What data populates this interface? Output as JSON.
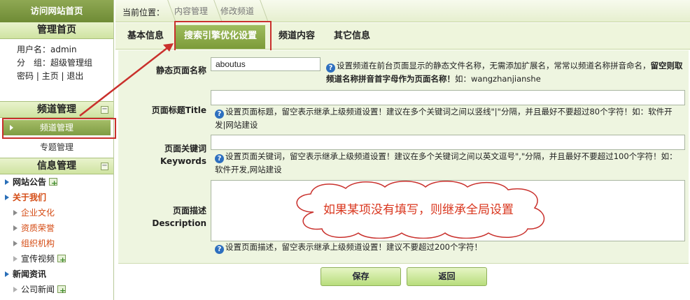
{
  "sidebar": {
    "top_link": "访问网站首页",
    "manage_home": "管理首页",
    "user": {
      "name_label": "用户名：",
      "name_value": "admin",
      "group_label": "分　组：",
      "group_value": "超级管理组",
      "links": [
        "密码",
        "主页",
        "退出"
      ]
    },
    "channel_section": "频道管理",
    "channel_items": [
      "频道管理",
      "专题管理"
    ],
    "info_section": "信息管理",
    "tree": [
      {
        "label": "网站公告",
        "level": 1,
        "style": "bold",
        "add": true
      },
      {
        "label": "关于我们",
        "level": 1,
        "style": "red",
        "add": false
      },
      {
        "label": "企业文化",
        "level": 2,
        "style": "orange",
        "add": false
      },
      {
        "label": "资质荣誉",
        "level": 2,
        "style": "orange",
        "add": false
      },
      {
        "label": "组织机构",
        "level": 2,
        "style": "orange",
        "add": false
      },
      {
        "label": "宣传视频",
        "level": 2,
        "style": "normal",
        "add": true
      },
      {
        "label": "新闻资讯",
        "level": 1,
        "style": "bold",
        "add": false
      },
      {
        "label": "公司新闻",
        "level": 2,
        "style": "normal",
        "add": true
      }
    ]
  },
  "topbar": {
    "label": "当前位置：",
    "crumbs": [
      "内容管理",
      "修改频道"
    ]
  },
  "tabs": [
    "基本信息",
    "搜索引擎优化设置",
    "频道内容",
    "其它信息"
  ],
  "form": {
    "static_name": {
      "label": "静态页面名称",
      "value": "aboutus",
      "help_pre": "设置频道在前台页面显示的静态文件名称，无需添加扩展名，常常以频道名称拼音命名，",
      "help_bold": "留空则取频道名称拼音首字母作为页面名称！",
      "help_post": "如：wangzhanjianshe"
    },
    "page_title": {
      "label": "页面标题",
      "label_en": "Title",
      "value": "",
      "help": "设置页面标题，留空表示继承上级频道设置！建议在多个关键词之间以竖线\"|\"分隔，并且最好不要超过80个字符！如：软件开发|网站建设"
    },
    "keywords": {
      "label": "页面关键词",
      "label_en": "Keywords",
      "value": "",
      "help": "设置页面关键词，留空表示继承上级频道设置！建议在多个关键词之间以英文逗号\",\"分隔，并且最好不要超过100个字符！如：软件开发,网站建设"
    },
    "description": {
      "label": "页面描述",
      "label_en": "Description",
      "value": "",
      "help": "设置页面描述，留空表示继承上级频道设置！建议不要超过200个字符！"
    }
  },
  "callout": "如果某项没有填写，则继承全局设置",
  "buttons": {
    "save": "保存",
    "back": "返回"
  },
  "colors": {
    "accent_green": "#7c9b39",
    "highlight_red": "#c9302c",
    "callout_text": "#d9361e",
    "help_icon": "#2d6fbf"
  }
}
